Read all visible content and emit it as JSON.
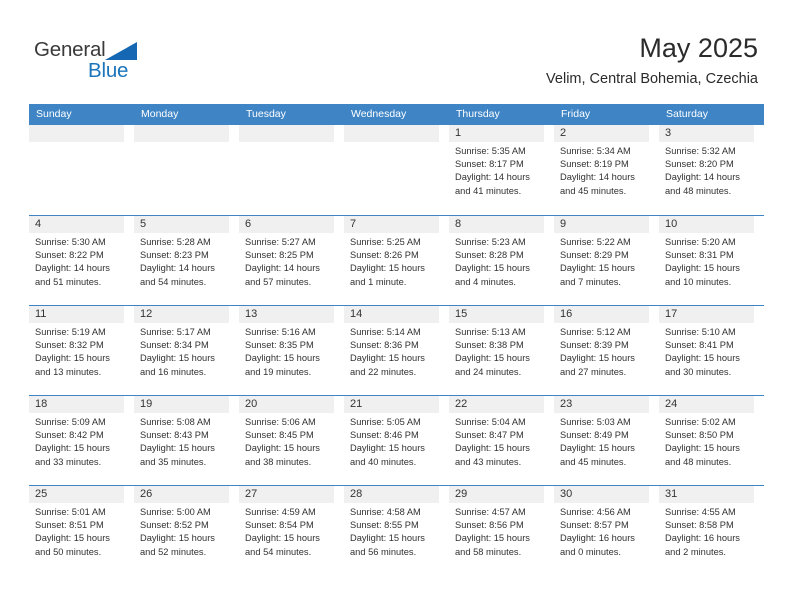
{
  "brand": {
    "name_top": "General",
    "name_bottom": "Blue",
    "triangle_icon": "triangle-icon",
    "accent_color": "#1b75bb"
  },
  "header": {
    "title": "May 2025",
    "subtitle": "Velim, Central Bohemia, Czechia"
  },
  "calendar": {
    "header_bg": "#3f85c6",
    "day_band_bg": "#f0f0f0",
    "weekdays": [
      "Sunday",
      "Monday",
      "Tuesday",
      "Wednesday",
      "Thursday",
      "Friday",
      "Saturday"
    ],
    "weeks": [
      [
        {
          "day": "",
          "lines": []
        },
        {
          "day": "",
          "lines": []
        },
        {
          "day": "",
          "lines": []
        },
        {
          "day": "",
          "lines": []
        },
        {
          "day": "1",
          "lines": [
            "Sunrise: 5:35 AM",
            "Sunset: 8:17 PM",
            "Daylight: 14 hours",
            "and 41 minutes."
          ]
        },
        {
          "day": "2",
          "lines": [
            "Sunrise: 5:34 AM",
            "Sunset: 8:19 PM",
            "Daylight: 14 hours",
            "and 45 minutes."
          ]
        },
        {
          "day": "3",
          "lines": [
            "Sunrise: 5:32 AM",
            "Sunset: 8:20 PM",
            "Daylight: 14 hours",
            "and 48 minutes."
          ]
        }
      ],
      [
        {
          "day": "4",
          "lines": [
            "Sunrise: 5:30 AM",
            "Sunset: 8:22 PM",
            "Daylight: 14 hours",
            "and 51 minutes."
          ]
        },
        {
          "day": "5",
          "lines": [
            "Sunrise: 5:28 AM",
            "Sunset: 8:23 PM",
            "Daylight: 14 hours",
            "and 54 minutes."
          ]
        },
        {
          "day": "6",
          "lines": [
            "Sunrise: 5:27 AM",
            "Sunset: 8:25 PM",
            "Daylight: 14 hours",
            "and 57 minutes."
          ]
        },
        {
          "day": "7",
          "lines": [
            "Sunrise: 5:25 AM",
            "Sunset: 8:26 PM",
            "Daylight: 15 hours",
            "and 1 minute."
          ]
        },
        {
          "day": "8",
          "lines": [
            "Sunrise: 5:23 AM",
            "Sunset: 8:28 PM",
            "Daylight: 15 hours",
            "and 4 minutes."
          ]
        },
        {
          "day": "9",
          "lines": [
            "Sunrise: 5:22 AM",
            "Sunset: 8:29 PM",
            "Daylight: 15 hours",
            "and 7 minutes."
          ]
        },
        {
          "day": "10",
          "lines": [
            "Sunrise: 5:20 AM",
            "Sunset: 8:31 PM",
            "Daylight: 15 hours",
            "and 10 minutes."
          ]
        }
      ],
      [
        {
          "day": "11",
          "lines": [
            "Sunrise: 5:19 AM",
            "Sunset: 8:32 PM",
            "Daylight: 15 hours",
            "and 13 minutes."
          ]
        },
        {
          "day": "12",
          "lines": [
            "Sunrise: 5:17 AM",
            "Sunset: 8:34 PM",
            "Daylight: 15 hours",
            "and 16 minutes."
          ]
        },
        {
          "day": "13",
          "lines": [
            "Sunrise: 5:16 AM",
            "Sunset: 8:35 PM",
            "Daylight: 15 hours",
            "and 19 minutes."
          ]
        },
        {
          "day": "14",
          "lines": [
            "Sunrise: 5:14 AM",
            "Sunset: 8:36 PM",
            "Daylight: 15 hours",
            "and 22 minutes."
          ]
        },
        {
          "day": "15",
          "lines": [
            "Sunrise: 5:13 AM",
            "Sunset: 8:38 PM",
            "Daylight: 15 hours",
            "and 24 minutes."
          ]
        },
        {
          "day": "16",
          "lines": [
            "Sunrise: 5:12 AM",
            "Sunset: 8:39 PM",
            "Daylight: 15 hours",
            "and 27 minutes."
          ]
        },
        {
          "day": "17",
          "lines": [
            "Sunrise: 5:10 AM",
            "Sunset: 8:41 PM",
            "Daylight: 15 hours",
            "and 30 minutes."
          ]
        }
      ],
      [
        {
          "day": "18",
          "lines": [
            "Sunrise: 5:09 AM",
            "Sunset: 8:42 PM",
            "Daylight: 15 hours",
            "and 33 minutes."
          ]
        },
        {
          "day": "19",
          "lines": [
            "Sunrise: 5:08 AM",
            "Sunset: 8:43 PM",
            "Daylight: 15 hours",
            "and 35 minutes."
          ]
        },
        {
          "day": "20",
          "lines": [
            "Sunrise: 5:06 AM",
            "Sunset: 8:45 PM",
            "Daylight: 15 hours",
            "and 38 minutes."
          ]
        },
        {
          "day": "21",
          "lines": [
            "Sunrise: 5:05 AM",
            "Sunset: 8:46 PM",
            "Daylight: 15 hours",
            "and 40 minutes."
          ]
        },
        {
          "day": "22",
          "lines": [
            "Sunrise: 5:04 AM",
            "Sunset: 8:47 PM",
            "Daylight: 15 hours",
            "and 43 minutes."
          ]
        },
        {
          "day": "23",
          "lines": [
            "Sunrise: 5:03 AM",
            "Sunset: 8:49 PM",
            "Daylight: 15 hours",
            "and 45 minutes."
          ]
        },
        {
          "day": "24",
          "lines": [
            "Sunrise: 5:02 AM",
            "Sunset: 8:50 PM",
            "Daylight: 15 hours",
            "and 48 minutes."
          ]
        }
      ],
      [
        {
          "day": "25",
          "lines": [
            "Sunrise: 5:01 AM",
            "Sunset: 8:51 PM",
            "Daylight: 15 hours",
            "and 50 minutes."
          ]
        },
        {
          "day": "26",
          "lines": [
            "Sunrise: 5:00 AM",
            "Sunset: 8:52 PM",
            "Daylight: 15 hours",
            "and 52 minutes."
          ]
        },
        {
          "day": "27",
          "lines": [
            "Sunrise: 4:59 AM",
            "Sunset: 8:54 PM",
            "Daylight: 15 hours",
            "and 54 minutes."
          ]
        },
        {
          "day": "28",
          "lines": [
            "Sunrise: 4:58 AM",
            "Sunset: 8:55 PM",
            "Daylight: 15 hours",
            "and 56 minutes."
          ]
        },
        {
          "day": "29",
          "lines": [
            "Sunrise: 4:57 AM",
            "Sunset: 8:56 PM",
            "Daylight: 15 hours",
            "and 58 minutes."
          ]
        },
        {
          "day": "30",
          "lines": [
            "Sunrise: 4:56 AM",
            "Sunset: 8:57 PM",
            "Daylight: 16 hours",
            "and 0 minutes."
          ]
        },
        {
          "day": "31",
          "lines": [
            "Sunrise: 4:55 AM",
            "Sunset: 8:58 PM",
            "Daylight: 16 hours",
            "and 2 minutes."
          ]
        }
      ]
    ]
  }
}
